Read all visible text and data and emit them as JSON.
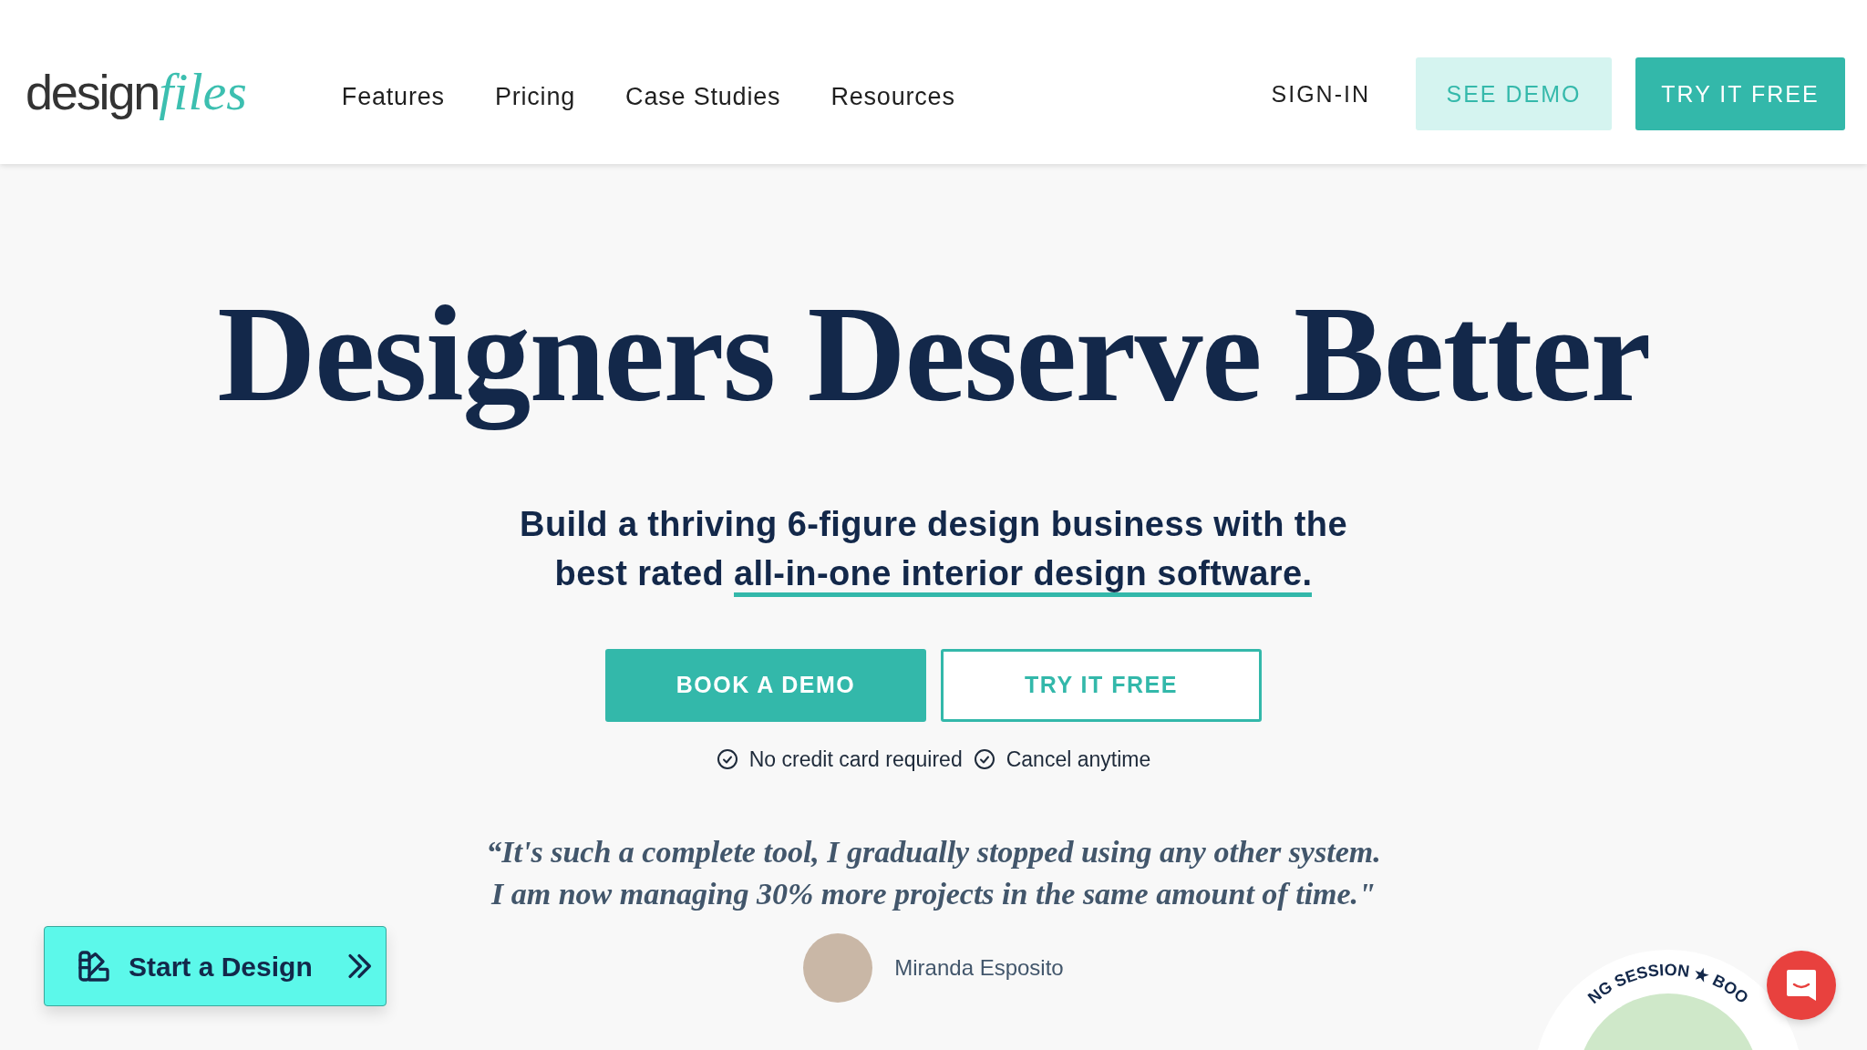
{
  "header": {
    "logo": {
      "word": "design",
      "accent": "files"
    },
    "nav": [
      {
        "label": "Features"
      },
      {
        "label": "Pricing"
      },
      {
        "label": "Case Studies"
      },
      {
        "label": "Resources"
      }
    ],
    "actions": [
      {
        "kind": "link",
        "label": "SIGN-IN"
      },
      {
        "kind": "secondary",
        "label": "SEE DEMO"
      },
      {
        "kind": "primary",
        "label": "TRY IT FREE"
      }
    ]
  },
  "hero": {
    "title": "Designers Deserve Better",
    "subtitle": {
      "text": "Build a thriving 6-figure design business with the best rated",
      "highlight": "all-in-one interior design software."
    },
    "buttons": [
      {
        "kind": "primary",
        "label": "BOOK A DEMO"
      },
      {
        "kind": "outline",
        "label": "TRY IT FREE"
      }
    ],
    "perks": [
      "No credit card required",
      "Cancel anytime"
    ],
    "testimonial": {
      "lines": [
        "“It's such a complete tool, I gradually stopped using any other system.",
        "I am now managing 30% more projects in the same amount of time.\""
      ],
      "author": "Miranda Esposito"
    }
  },
  "floating": {
    "start_button": "Start a Design",
    "badge_text": "NG SESSION ★ BOO"
  }
}
